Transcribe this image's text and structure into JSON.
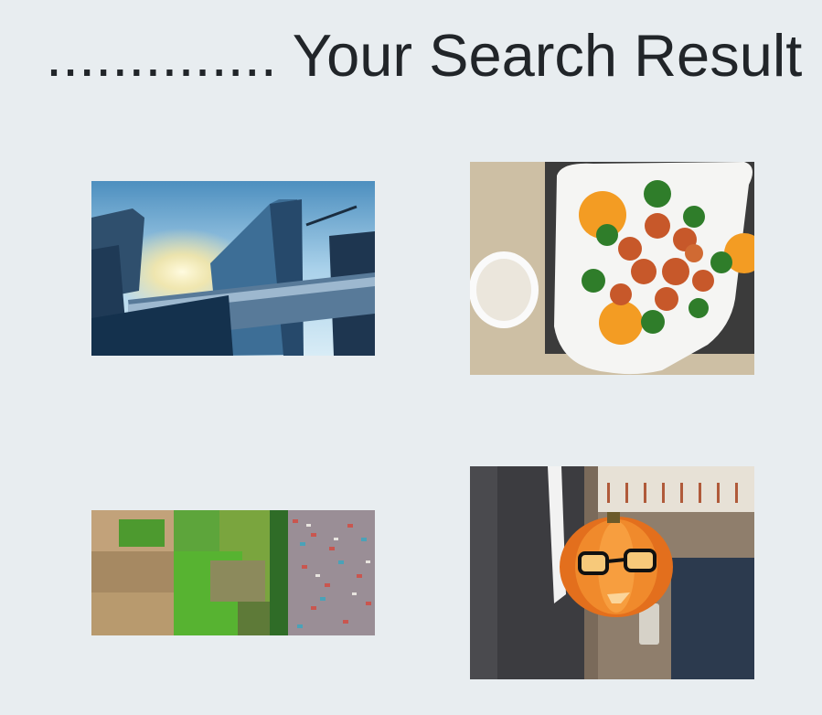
{
  "page": {
    "title": ".............. Your Search Result"
  },
  "results": [
    {
      "subject": "skyscrapers-and-skybridge"
    },
    {
      "subject": "orange-chicken-with-broccoli-and-rice"
    },
    {
      "subject": "aerial-farmland-and-town"
    },
    {
      "subject": "jack-o-lantern-with-glasses"
    }
  ],
  "colors": {
    "background": "#e8edf0",
    "title_text": "#212529"
  }
}
